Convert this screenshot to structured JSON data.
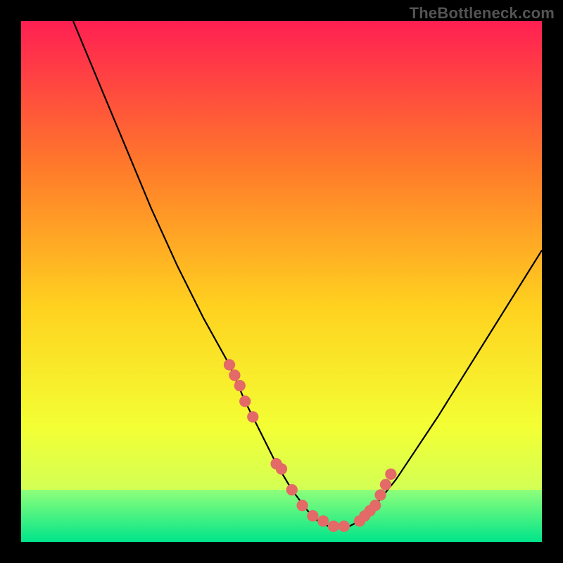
{
  "watermark": "TheBottleneck.com",
  "colors": {
    "gradient_top": "#ff1f52",
    "gradient_upper_mid": "#ff7a2a",
    "gradient_mid": "#ffd21f",
    "gradient_lower_mid": "#f3ff34",
    "gradient_bottom": "#cdff5a",
    "green_top": "#8fff7a",
    "green_bottom": "#00e58a",
    "dot": "#e36a66",
    "curve": "#000000",
    "frame": "#000000",
    "watermark": "#545454"
  },
  "chart_data": {
    "type": "line",
    "title": "",
    "xlabel": "",
    "ylabel": "",
    "xlim": [
      0,
      100
    ],
    "ylim": [
      0,
      100
    ],
    "grid": false,
    "legend": false,
    "annotations": [
      "TheBottleneck.com"
    ],
    "green_band": {
      "from_y": 90,
      "to_y": 100
    },
    "series": [
      {
        "name": "bottleneck-curve",
        "x": [
          10,
          15,
          20,
          25,
          30,
          35,
          40,
          43,
          46,
          49,
          52,
          55,
          57,
          59,
          61,
          63,
          65,
          68,
          72,
          76,
          80,
          85,
          90,
          95,
          100
        ],
        "y": [
          0,
          12,
          24,
          36,
          47,
          57,
          66,
          73,
          79,
          85,
          90,
          94,
          96,
          97,
          97,
          97,
          96,
          93,
          88,
          82,
          76,
          68,
          60,
          52,
          44
        ]
      }
    ],
    "dots": {
      "name": "highlighted-points",
      "x": [
        40,
        41,
        42,
        43,
        44.5,
        49,
        50,
        52,
        54,
        56,
        58,
        60,
        62,
        65,
        66,
        67,
        68,
        69,
        70,
        71
      ],
      "y": [
        66,
        68,
        70,
        73,
        76,
        85,
        86,
        90,
        93,
        95,
        96,
        97,
        97,
        96,
        95,
        94,
        93,
        91,
        89,
        87
      ]
    }
  }
}
